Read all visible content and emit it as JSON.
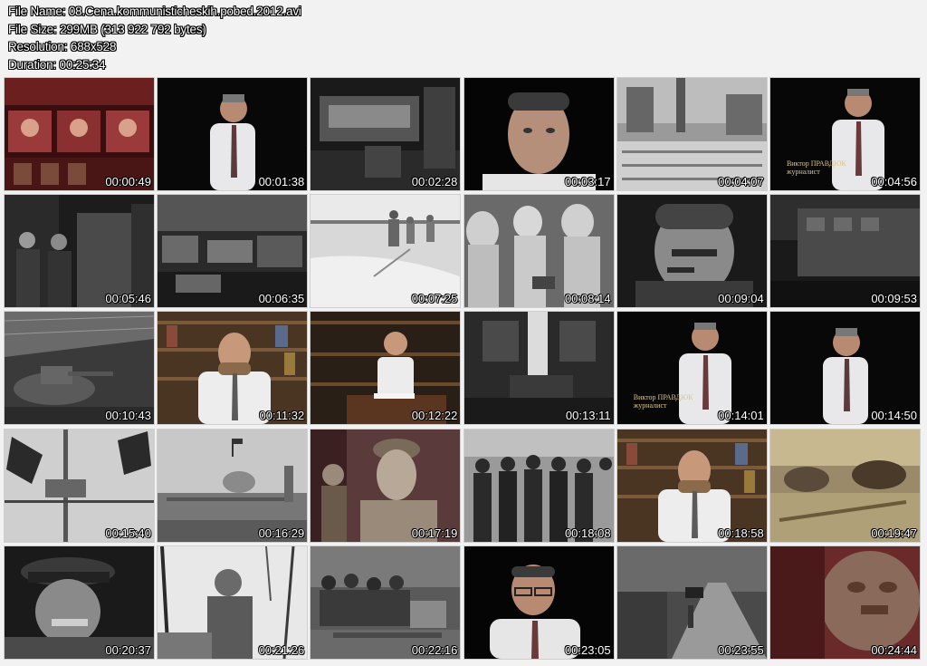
{
  "file_info": {
    "name_line": "File Name: 08.Cena.kommunisticheskih.pobed.2012.avi",
    "size_line": "File Size: 299MB (313 922 792 bytes)",
    "resolution_line": "Resolution: 688x528",
    "duration_line": "Duration: 00:25:34"
  },
  "thumbnails": [
    {
      "time": "00:00:49",
      "scene": "title-collage"
    },
    {
      "time": "00:01:38",
      "scene": "presenter"
    },
    {
      "time": "00:02:28",
      "scene": "archive-room"
    },
    {
      "time": "00:03:17",
      "scene": "presenter-closeup"
    },
    {
      "time": "00:04:07",
      "scene": "parade"
    },
    {
      "time": "00:04:56",
      "scene": "presenter-captioned",
      "caption": "Виктор ПРАВДЮК\nжурналист"
    },
    {
      "time": "00:05:46",
      "scene": "officers"
    },
    {
      "time": "00:06:35",
      "scene": "factory"
    },
    {
      "time": "00:07:25",
      "scene": "snow-soldiers"
    },
    {
      "time": "00:08:14",
      "scene": "soldiers-white"
    },
    {
      "time": "00:09:04",
      "scene": "stalin-pipe"
    },
    {
      "time": "00:09:53",
      "scene": "train"
    },
    {
      "time": "00:10:43",
      "scene": "tank-factory"
    },
    {
      "time": "00:11:32",
      "scene": "historian-library"
    },
    {
      "time": "00:12:22",
      "scene": "historian-desk"
    },
    {
      "time": "00:13:11",
      "scene": "empty-room"
    },
    {
      "time": "00:14:01",
      "scene": "presenter-captioned",
      "caption": "Виктор ПРАВДЮК\nжурналист"
    },
    {
      "time": "00:14:50",
      "scene": "presenter"
    },
    {
      "time": "00:15:40",
      "scene": "loudspeakers"
    },
    {
      "time": "00:16:29",
      "scene": "kremlin"
    },
    {
      "time": "00:17:19",
      "scene": "soldier-helmet"
    },
    {
      "time": "00:18:08",
      "scene": "tank-crew"
    },
    {
      "time": "00:18:58",
      "scene": "historian-library"
    },
    {
      "time": "00:19:47",
      "scene": "battle-sepia"
    },
    {
      "time": "00:20:37",
      "scene": "stalin-cap"
    },
    {
      "time": "00:21:26",
      "scene": "statue"
    },
    {
      "time": "00:22:16",
      "scene": "crowd"
    },
    {
      "time": "00:23:05",
      "scene": "presenter-glasses"
    },
    {
      "time": "00:23:55",
      "scene": "forest-road"
    },
    {
      "time": "00:24:44",
      "scene": "stone-face"
    }
  ]
}
